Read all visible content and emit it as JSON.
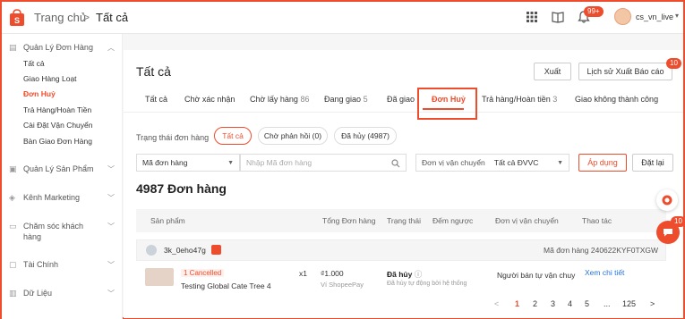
{
  "header": {
    "breadcrumb_home": "Trang chủ",
    "breadcrumb_sep": ">",
    "breadcrumb_current": "Tất cả",
    "notif_badge": "99+",
    "username": "cs_vn_live",
    "brand_color": "#ee4d2d"
  },
  "sidebar": {
    "sections": [
      {
        "label": "Quản Lý Đơn Hàng",
        "icon": "clipboard-icon"
      },
      {
        "label": "Quản Lý Sản Phẩm",
        "icon": "box-icon"
      },
      {
        "label": "Kênh Marketing",
        "icon": "tag-icon"
      },
      {
        "label": "Chăm sóc khách hàng",
        "label_line1": "Chăm sóc khách",
        "label_line2": "hàng",
        "icon": "message-icon"
      },
      {
        "label": "Tài Chính",
        "icon": "wallet-icon"
      },
      {
        "label": "Dữ Liệu",
        "icon": "chart-icon"
      }
    ],
    "order_items": [
      "Tất cả",
      "Giao Hàng Loạt",
      "Đơn Huỷ",
      "Trả Hàng/Hoàn Tiền",
      "Cài Đặt Vận Chuyển",
      "Bàn Giao Đơn Hàng"
    ]
  },
  "main": {
    "title": "Tất cả",
    "export_button": "Xuất",
    "export_history_button": "Lịch sử Xuất Báo cáo",
    "export_history_badge": "10",
    "tabs": [
      {
        "label": "Tất cả",
        "count": ""
      },
      {
        "label": "Chờ xác nhận",
        "count": ""
      },
      {
        "label": "Chờ lấy hàng",
        "count": "86"
      },
      {
        "label": "Đang giao",
        "count": "5"
      },
      {
        "label": "Đã giao",
        "count": ""
      },
      {
        "label": "Đơn Huỷ",
        "count": ""
      },
      {
        "label": "Trả hàng/Hoàn tiền",
        "count": "3"
      },
      {
        "label": "Giao không thành công",
        "count": ""
      }
    ],
    "status_label": "Trạng thái đơn hàng",
    "status_pills": [
      "Tất cả",
      "Chờ phản hồi (0)",
      "Đã hủy (4987)"
    ],
    "search_type": "Mã đơn hàng",
    "search_placeholder": "Nhập Mã đơn hàng",
    "carrier_label": "Đơn vị vận chuyển",
    "carrier_value": "Tất cả ĐVVC",
    "apply_button": "Áp dụng",
    "reset_button": "Đặt lại",
    "order_count_title": "4987 Đơn hàng",
    "table_headers": [
      "Sản phẩm",
      "Tổng Đơn hàng",
      "Trạng thái",
      "Đếm ngược",
      "Đơn vị vận chuyển",
      "Thao tác"
    ],
    "order": {
      "buyer": "3k_0eho47g",
      "order_id": "Mã đơn hàng 240622KYF0TXGW",
      "tag": "1 Cancelled",
      "product_name": "Testing Global Cate Tree 4",
      "qty": "x1",
      "price": "₫1.000",
      "payment": "Ví ShopeePay",
      "status": "Đã hủy",
      "status_sub": "Đã hủy tự động bởi hệ thống",
      "carrier": "Người bán tự vận chuy",
      "action": "Xem chi tiết"
    },
    "pagination": [
      "<",
      "1",
      "2",
      "3",
      "4",
      "5",
      "...",
      "125",
      ">"
    ]
  },
  "floating": {
    "chat_badge": "10"
  }
}
